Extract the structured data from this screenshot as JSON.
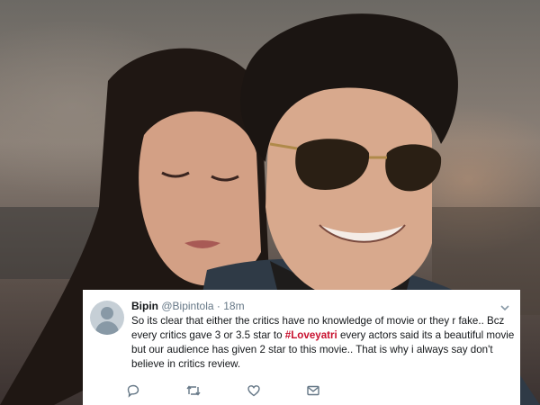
{
  "tweet": {
    "name": "Bipin",
    "handle": "@Bipintola",
    "separator": "·",
    "time": "18m",
    "text_before": "So its clear that either the critics have no knowledge of movie or they r fake.. Bcz every critics gave 3 or 3.5 star to ",
    "hashtag": "#Loveyatri",
    "text_after": " every actors said its a beautiful movie but our audience has given 2 star to this movie.. That is why i always say don't believe in critics review."
  },
  "icons": {
    "avatar": "default-avatar-icon",
    "caret": "chevron-down-icon",
    "reply": "reply-icon",
    "retweet": "retweet-icon",
    "like": "heart-icon",
    "message": "envelope-icon"
  },
  "colors": {
    "hashtag": "#c8102e",
    "secondary_text": "#657786",
    "icon": "#657786"
  }
}
